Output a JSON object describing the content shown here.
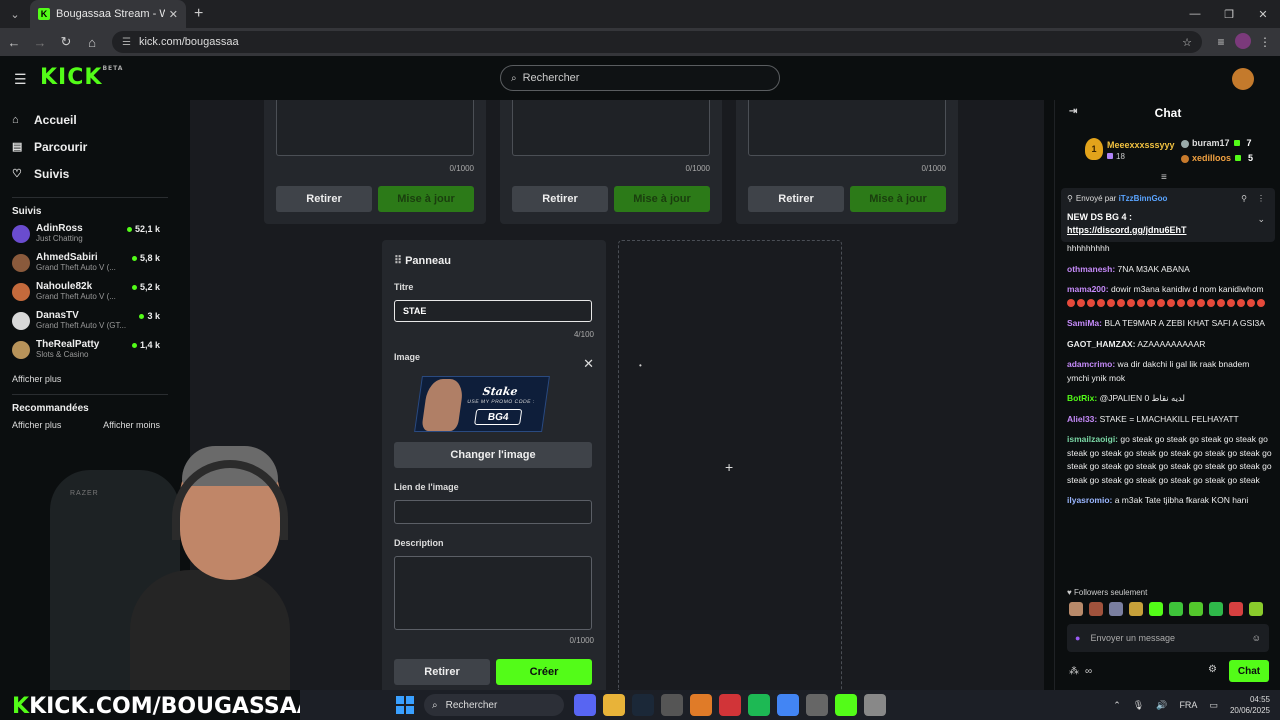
{
  "browser": {
    "tab_title": "Bougassaa Stream - Watch Live",
    "url": "kick.com/bougassaa"
  },
  "header": {
    "search_placeholder": "Rechercher"
  },
  "sidebar": {
    "nav": [
      {
        "label": "Accueil",
        "icon": "home-icon"
      },
      {
        "label": "Parcourir",
        "icon": "browse-icon"
      },
      {
        "label": "Suivis",
        "icon": "heart-icon"
      }
    ],
    "followed_title": "Suivis",
    "channels": [
      {
        "name": "AdinRoss",
        "category": "Just Chatting",
        "viewers": "52,1 k",
        "color": "#6a4ccf"
      },
      {
        "name": "AhmedSabiri",
        "category": "Grand Theft Auto V (...",
        "viewers": "5,8 k",
        "color": "#8a5a3c"
      },
      {
        "name": "Nahoule82k",
        "category": "Grand Theft Auto V (...",
        "viewers": "5,2 k",
        "color": "#c46a3c"
      },
      {
        "name": "DanasTV",
        "category": "Grand Theft Auto V (GT...",
        "viewers": "3 k",
        "color": "#d8d8d8"
      },
      {
        "name": "TheRealPatty",
        "category": "Slots & Casino",
        "viewers": "1,4 k",
        "color": "#b8935a"
      }
    ],
    "show_more": "Afficher plus",
    "recommended_title": "Recommandées",
    "rec_show_more": "Afficher plus",
    "rec_show_less": "Afficher moins"
  },
  "panels": [
    {
      "counter": "0/1000",
      "remove": "Retirer",
      "update": "Mise à jour"
    },
    {
      "counter": "0/1000",
      "remove": "Retirer",
      "update": "Mise à jour"
    },
    {
      "counter": "0/1000",
      "remove": "Retirer",
      "update": "Mise à jour"
    }
  ],
  "editor": {
    "title": "Panneau",
    "title_label": "Titre",
    "title_value": "STAE",
    "title_counter": "4/100",
    "image_label": "Image",
    "promo": {
      "brand": "Stake",
      "promo_text": "USE MY PROMO CODE :",
      "code": "BG4"
    },
    "change_image": "Changer l'image",
    "link_label": "Lien de l'image",
    "link_value": "",
    "desc_label": "Description",
    "desc_value": "",
    "desc_counter": "0/1000",
    "remove": "Retirer",
    "create": "Créer"
  },
  "overlay": {
    "prefix": "K",
    "text": "KICK.COM/BOUGASSAA"
  },
  "chat": {
    "title": "Chat",
    "leaderboard": {
      "top": {
        "rank": "1",
        "name": "Meeexxxsssyyy",
        "count": "18"
      },
      "second": {
        "name": "buram17",
        "count": "7"
      },
      "third": {
        "name": "xedilloos",
        "count": "5"
      }
    },
    "pinned": {
      "sent_by_label": "Envoyé par",
      "sender": "iTzzBinnGoo",
      "line1": "NEW DS BG 4 :",
      "line2": "https://discord.gg/jdnu6EhT"
    },
    "messages": [
      {
        "user": "",
        "text": "hhhhhhhhh",
        "color": "#eee"
      },
      {
        "user": "othmanesh:",
        "text": " 7NA M3AK ABANA",
        "color": "#c58af9"
      },
      {
        "user": "mama200:",
        "text": " dowir m3ana kanidiw d nom kanidiwhom",
        "color": "#c58af9"
      },
      {
        "user": "SamiMa:",
        "text": " BLA TE9MAR A ZEBI KHAT SAFI A GSI3A",
        "color": "#c58af9"
      },
      {
        "user": "GAOT_HAMZAX:",
        "text": " AZAAAAAAAAAR",
        "color": "#eee"
      },
      {
        "user": "adamcrimo:",
        "text": " wa dir dakchi li gal lik raak bnadem ymchi ynik mok",
        "color": "#c58af9"
      },
      {
        "user": "BotRix:",
        "text": " @JPALIEN 0 لديه نقاط",
        "color": "#53fc18"
      },
      {
        "user": "Aliel33:",
        "text": " STAKE = LMACHAKILL FELHAYATT",
        "color": "#c58af9"
      },
      {
        "user": "ismailzaoigi:",
        "text": " go steak go steak go steak go steak go steak go steak go steak go steak go steak go steak go steak go steak go steak go steak go steak go steak go steak go steak go steak go steak go steak go steak",
        "color": "#7ad7a5"
      },
      {
        "user": "ilyasromio:",
        "text": " a m3ak Tate tjibha fkarak KON hani",
        "color": "#9ab6ff"
      }
    ],
    "followers_only": "Followers seulement",
    "input_placeholder": "Envoyer un message",
    "send": "Chat"
  },
  "taskbar": {
    "search": "Rechercher",
    "lang": "FRA",
    "time": "04:55",
    "date": "20/06/2025"
  }
}
